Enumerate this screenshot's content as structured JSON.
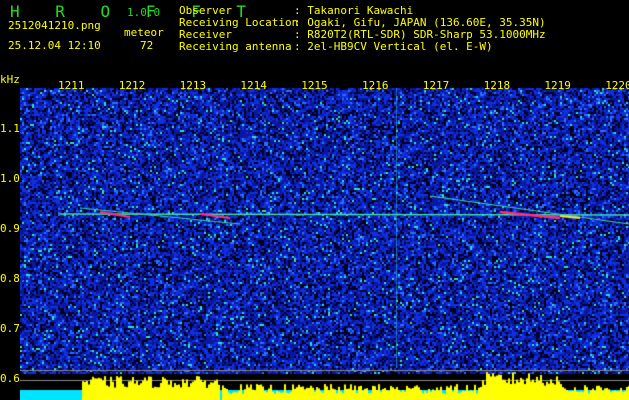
{
  "app": {
    "name": "H R O F F T",
    "version": "1.0.0"
  },
  "file": {
    "name": "2512041210.png",
    "datetime": "25.12.04 12:10"
  },
  "meteor": {
    "label": "meteor",
    "count": "72"
  },
  "info": [
    {
      "label": "Observer",
      "value": ": Takanori Kawachi"
    },
    {
      "label": "Receiving Location",
      "value": ": Ogaki, Gifu, JAPAN (136.60E, 35.35N)"
    },
    {
      "label": "Receiver",
      "value": ": R820T2(RTL-SDR) SDR-Sharp 53.1000MHz"
    },
    {
      "label": "Receiving antenna",
      "value": ": 2el-HB9CV Vertical (el. E-W)"
    }
  ],
  "axis": {
    "unit": "kHz",
    "time_ticks": [
      "1211",
      "1212",
      "1213",
      "1214",
      "1215",
      "1216",
      "1217",
      "1218",
      "1219",
      "1220"
    ],
    "freq_ticks": [
      "1.1",
      "1.0",
      "0.9",
      "0.8",
      "0.7",
      "0.6"
    ]
  },
  "colors": {
    "text": "#ffff00",
    "logo": "#22dd22",
    "noise": "#0a1fc8",
    "level": "#ffff00",
    "base": "#00e5ff"
  }
}
